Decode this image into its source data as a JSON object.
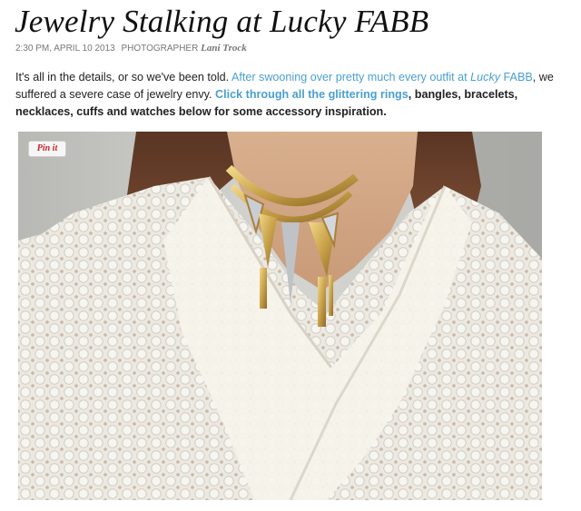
{
  "article": {
    "title": "Jewelry Stalking at Lucky FABB",
    "meta": {
      "timestamp": "2:30 PM, APRIL 10 2013",
      "role": "PHOTOGRAPHER",
      "author": "Lani Trock"
    },
    "intro": {
      "part1": "It's all in the details, or so we've been told. ",
      "link1_a": "After swooning over pretty much every outfit at ",
      "link1_italic": "Lucky",
      "link1_b": " FABB",
      "part2": ", we suffered a severe case of jewelry envy. ",
      "link2": "Click through all the glittering rings",
      "part3": ", bangles, bracelets, necklaces, cuffs and watches below for some accessory inspiration."
    },
    "pin_button": "Pin it"
  },
  "colors": {
    "link": "#4a9fd1",
    "pin": "#cb2027"
  },
  "image": {
    "icon": "photo-woman-gold-necklace"
  }
}
